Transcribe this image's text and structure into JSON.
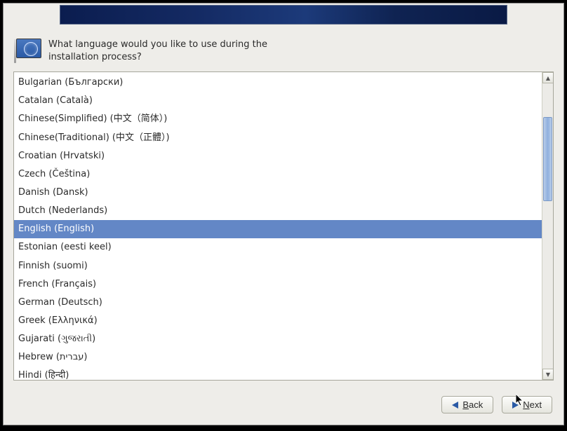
{
  "prompt": "What language would you like to use during the installation process?",
  "languages": [
    {
      "label": "Bulgarian (Български)",
      "selected": false
    },
    {
      "label": "Catalan (Català)",
      "selected": false
    },
    {
      "label": "Chinese(Simplified) (中文（简体）)",
      "selected": false
    },
    {
      "label": "Chinese(Traditional) (中文（正體）)",
      "selected": false
    },
    {
      "label": "Croatian (Hrvatski)",
      "selected": false
    },
    {
      "label": "Czech (Čeština)",
      "selected": false
    },
    {
      "label": "Danish (Dansk)",
      "selected": false
    },
    {
      "label": "Dutch (Nederlands)",
      "selected": false
    },
    {
      "label": "English (English)",
      "selected": true
    },
    {
      "label": "Estonian (eesti keel)",
      "selected": false
    },
    {
      "label": "Finnish (suomi)",
      "selected": false
    },
    {
      "label": "French (Français)",
      "selected": false
    },
    {
      "label": "German (Deutsch)",
      "selected": false
    },
    {
      "label": "Greek (Ελληνικά)",
      "selected": false
    },
    {
      "label": "Gujarati (ગુજરાતી)",
      "selected": false
    },
    {
      "label": "Hebrew (עברית)",
      "selected": false
    },
    {
      "label": "Hindi (हिन्दी)",
      "selected": false
    }
  ],
  "buttons": {
    "back": {
      "pre": "",
      "mn": "B",
      "post": "ack"
    },
    "next": {
      "pre": "",
      "mn": "N",
      "post": "ext"
    }
  }
}
